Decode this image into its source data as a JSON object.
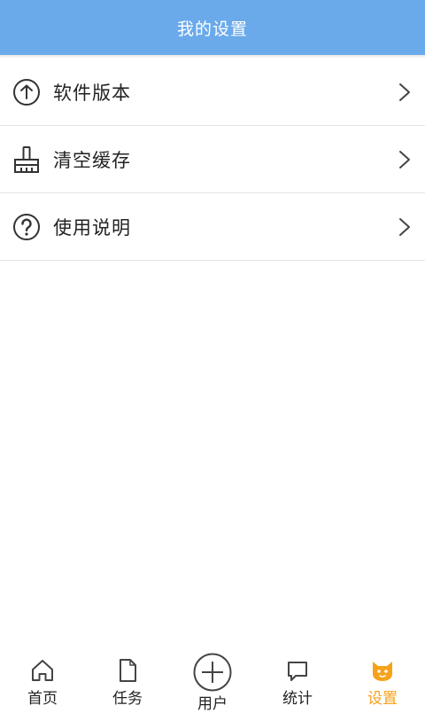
{
  "colors": {
    "header_bg": "#6aaaeb",
    "active_tab": "#f7a21b",
    "text": "#222222",
    "divider": "#e5e5e5"
  },
  "header": {
    "title": "我的设置"
  },
  "settings": {
    "items": [
      {
        "label": "软件版本",
        "icon": "arrow-up-circle-icon"
      },
      {
        "label": "清空缓存",
        "icon": "brush-icon"
      },
      {
        "label": "使用说明",
        "icon": "question-circle-icon"
      }
    ]
  },
  "tabbar": {
    "tabs": [
      {
        "label": "首页",
        "icon": "home-icon",
        "active": false
      },
      {
        "label": "任务",
        "icon": "document-icon",
        "active": false
      },
      {
        "label": "用户",
        "icon": "plus-circle-icon",
        "active": false
      },
      {
        "label": "统计",
        "icon": "chat-bubble-icon",
        "active": false
      },
      {
        "label": "设置",
        "icon": "cat-icon",
        "active": true
      }
    ]
  }
}
